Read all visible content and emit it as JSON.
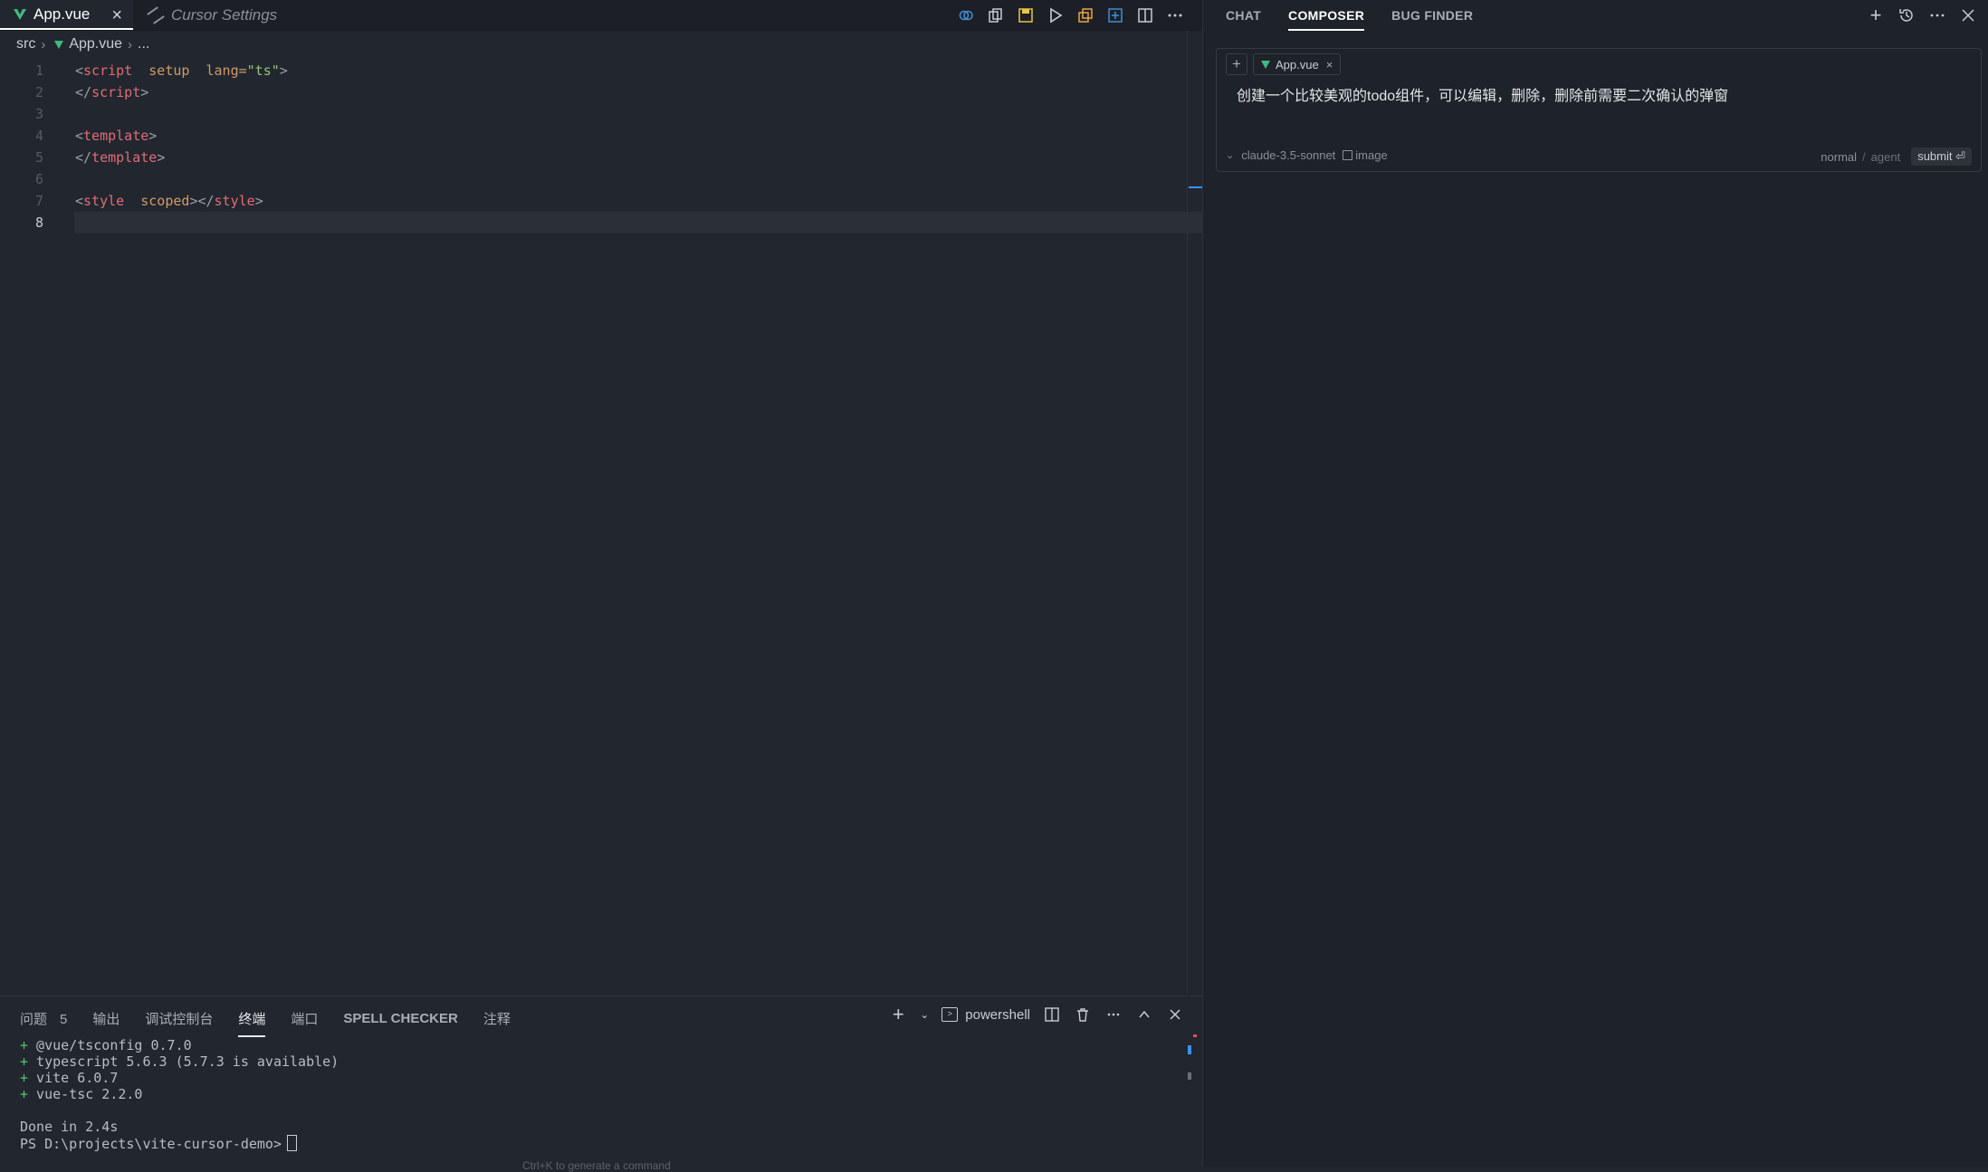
{
  "tabs": [
    {
      "label": "App.vue",
      "icon": "vue-icon",
      "active": true
    },
    {
      "label": "Cursor Settings",
      "icon": "settings-icon",
      "active": false
    }
  ],
  "editor_actions": [
    "link-icon",
    "diff-icon",
    "save-icon",
    "run-icon",
    "copy-icon",
    "add-panel-icon",
    "split-editor-icon",
    "more-icon"
  ],
  "breadcrumb": {
    "folder": "src",
    "file": "App.vue",
    "rest": "..."
  },
  "code": {
    "line_numbers": [
      "1",
      "2",
      "3",
      "4",
      "5",
      "6",
      "7",
      "8"
    ],
    "l1_open": "<",
    "l1_tag": "script",
    "l1_attr1": "setup",
    "l1_attr2": "lang=",
    "l1_val": "\"ts\"",
    "l1_close": ">",
    "l2_open": "</",
    "l2_tag": "script",
    "l2_close": ">",
    "l4_open": "<",
    "l4_tag": "template",
    "l4_close": ">",
    "l5_open": "</",
    "l5_tag": "template",
    "l5_close": ">",
    "l7_open": "<",
    "l7_tag": "style",
    "l7_attr": "scoped",
    "l7_mid": "></",
    "l7_tag2": "style",
    "l7_close": ">"
  },
  "panel": {
    "tabs": [
      "问题",
      "输出",
      "调试控制台",
      "终端",
      "端口",
      "SPELL CHECKER",
      "注释"
    ],
    "problems_count": "5",
    "active_tab": "终端",
    "shell": "powershell"
  },
  "terminal": {
    "lines": [
      {
        "prefix": "+",
        "text": " @vue/tsconfig 0.7.0"
      },
      {
        "prefix": "+",
        "text": " typescript 5.6.3 (5.7.3 is available)"
      },
      {
        "prefix": "+",
        "text": " vite 6.0.7"
      },
      {
        "prefix": "+",
        "text": " vue-tsc 2.2.0"
      }
    ],
    "done": "Done in 2.4s",
    "prompt": "PS D:\\projects\\vite-cursor-demo>",
    "hint": "Ctrl+K to generate a command"
  },
  "composer": {
    "tabs": [
      "CHAT",
      "COMPOSER",
      "BUG FINDER"
    ],
    "active_tab": "COMPOSER",
    "context_file": "App.vue",
    "prompt": "创建一个比较美观的todo组件，可以编辑，删除，删除前需要二次确认的弹窗",
    "model": "claude-3.5-sonnet",
    "image_label": "image",
    "mode_normal": "normal",
    "mode_sep": "/",
    "mode_agent": "agent",
    "submit": "submit ⏎"
  },
  "colors": {
    "accent": "#3794ff",
    "vue": "#42b883",
    "tag": "#e06c75",
    "string": "#98c379",
    "terminal_plus": "#4ec96b"
  }
}
